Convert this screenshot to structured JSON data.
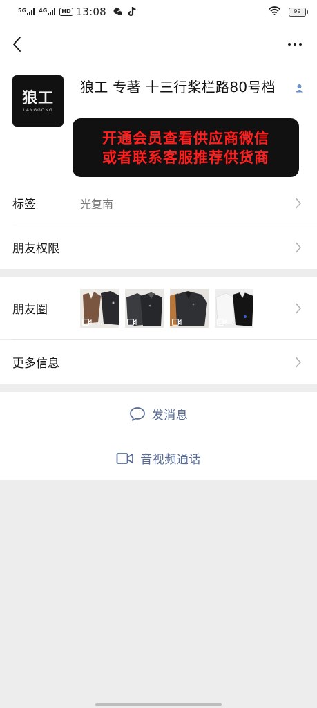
{
  "status_bar": {
    "net1": "5G",
    "net2": "4G",
    "hd": "HD",
    "time": "13:08",
    "battery": "99"
  },
  "profile": {
    "avatar_logo": "狼工",
    "avatar_sub": "LANGGONG",
    "name": "狼工 专著   十三行桨栏路80号档",
    "promo_line1": "开通会员查看供应商微信",
    "promo_line2": "或者联系客服推荐供货商"
  },
  "rows": {
    "tags_title": "标签",
    "tags_value": "光复南",
    "perm_title": "朋友权限",
    "moments_title": "朋友圈",
    "more_title": "更多信息"
  },
  "actions": {
    "message": "发消息",
    "call": "音视频通话"
  },
  "colors": {
    "accent": "#576b95",
    "promo_text": "#ff1f1f",
    "background": "#ededed"
  }
}
